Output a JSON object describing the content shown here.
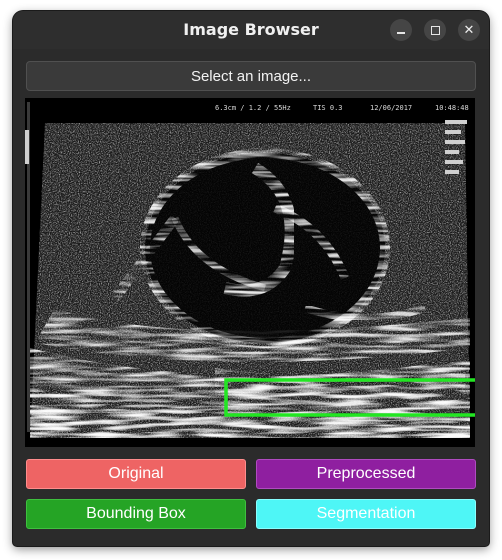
{
  "window": {
    "title": "Image Browser",
    "controls": [
      "minimize-icon",
      "maximize-icon",
      "close-icon"
    ]
  },
  "toolbar": {
    "select_label": "Select an image..."
  },
  "viewer": {
    "overlay_header": [
      "6.3cm / 1.2 / 55Hz",
      "TIS 0.3",
      "12/06/2017",
      "10:48:48"
    ],
    "bounding_box_color": "#22e622"
  },
  "buttons": {
    "original": "Original",
    "preprocessed": "Preprocessed",
    "bounding_box": "Bounding Box",
    "segmentation": "Segmentation"
  },
  "colors": {
    "original": "#ee6464",
    "preprocessed": "#8f1fa0",
    "bounding_box": "#25a425",
    "segmentation": "#4ef6f6"
  }
}
